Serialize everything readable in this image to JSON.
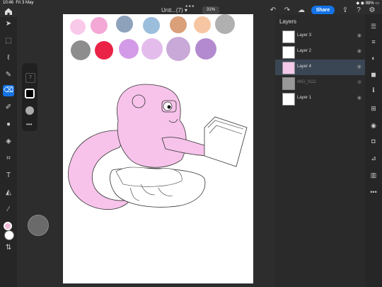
{
  "status_bar": {
    "time": "10:46",
    "date": "Fri 3 May",
    "battery": "98%"
  },
  "top_bar": {
    "dots": "•••",
    "document_title": "Unti...(7)",
    "zoom": "31%",
    "share_label": "Share"
  },
  "brush_panel": {
    "size_value": "7",
    "more_dots": "•••"
  },
  "layers_panel": {
    "title": "Layers",
    "layers": [
      {
        "name": "Layer 3",
        "visible": true
      },
      {
        "name": "Layer 2",
        "visible": true
      },
      {
        "name": "Layer 4",
        "visible": true,
        "selected": true
      },
      {
        "name": "IMG_0111",
        "visible": false
      },
      {
        "name": "Layer 1",
        "visible": true
      }
    ]
  },
  "swatches": [
    "#f9c9ea",
    "#f3a8d6",
    "#8ea3bb",
    "#9cbedd",
    "#d9a07a",
    "#f6c6a3",
    "#b0b0b0",
    "#8d8d8d",
    "#ea2245",
    "#d39be7",
    "#e4bcec",
    "#c8a9d7",
    "#b38ad0"
  ],
  "colors": {
    "accent": "#1473e6",
    "character_fill": "#f7c3ea"
  }
}
